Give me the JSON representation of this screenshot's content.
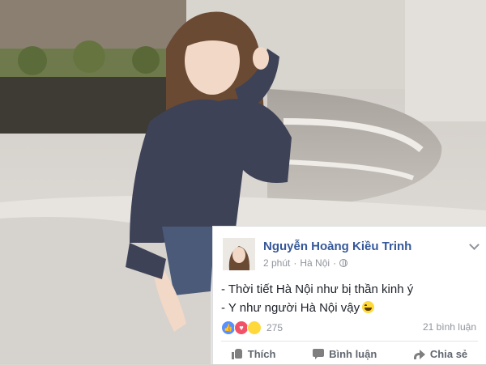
{
  "post": {
    "author": "Nguyễn Hoàng Kiều Trinh",
    "time": "2 phút",
    "separator": "·",
    "location": "Hà Nội",
    "lines": [
      "- Thời tiết Hà Nội như bị thần kinh ý",
      "- Y như người Hà Nội vậy"
    ],
    "reaction_count": "275",
    "comment_count": "21 bình luận"
  },
  "actions": {
    "like_label": "Thích",
    "comment_label": "Bình luận",
    "share_label": "Chia sẻ"
  },
  "icons": {
    "reactions": [
      "like-icon",
      "love-icon",
      "haha-icon"
    ],
    "action_icons": [
      "thumbs-up-icon",
      "comment-icon",
      "share-icon"
    ],
    "privacy": "globe-icon"
  },
  "colors": {
    "author_link": "#365899",
    "meta_text": "#90949c",
    "body_text": "#1d2129",
    "like_blue": "#5890ff",
    "love_red": "#f25268",
    "haha_yellow": "#ffd93b"
  }
}
